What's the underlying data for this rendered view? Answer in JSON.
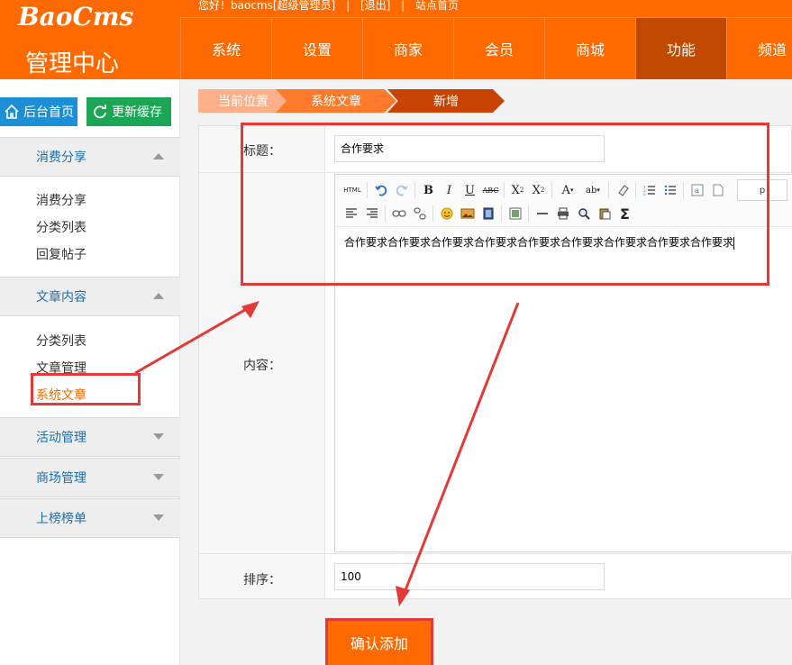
{
  "header": {
    "logo": "BaoCms",
    "admin_title": "管理中心",
    "topbar": {
      "greeting": "您好！baocms",
      "role": "[超级管理员]",
      "logout": "[退出]",
      "site_home": "站点首页",
      "sep": "|"
    },
    "nav": [
      "系统",
      "设置",
      "商家",
      "会员",
      "商城",
      "功能",
      "频道"
    ],
    "active_nav": "功能"
  },
  "sidebar": {
    "home_button": "后台首页",
    "cache_button": "更新缓存",
    "groups": [
      {
        "title": "消费分享",
        "expanded": true,
        "items": [
          "消费分享",
          "分类列表",
          "回复帖子"
        ]
      },
      {
        "title": "文章内容",
        "expanded": true,
        "items": [
          "分类列表",
          "文章管理",
          "系统文章"
        ]
      },
      {
        "title": "活动管理",
        "expanded": false,
        "items": []
      },
      {
        "title": "商场管理",
        "expanded": false,
        "items": []
      },
      {
        "title": "上榜榜单",
        "expanded": false,
        "items": []
      }
    ],
    "active_item": "系统文章"
  },
  "breadcrumb": [
    "当前位置",
    "系统文章",
    "新增"
  ],
  "form": {
    "title_label": "标题：",
    "title_value": "合作要求",
    "content_label": "内容：",
    "content_value": "合作要求合作要求合作要求合作要求合作要求合作要求合作要求合作要求合作要求",
    "sort_label": "排序：",
    "sort_value": "100",
    "submit_label": "确认添加"
  },
  "editor": {
    "html_button": "HTML",
    "paragraph_select": "p"
  },
  "colors": {
    "brand": "#ff6a00",
    "nav_active": "#c24a00",
    "sidebar_link": "#1a6fb0",
    "annotation": "#e53935"
  }
}
